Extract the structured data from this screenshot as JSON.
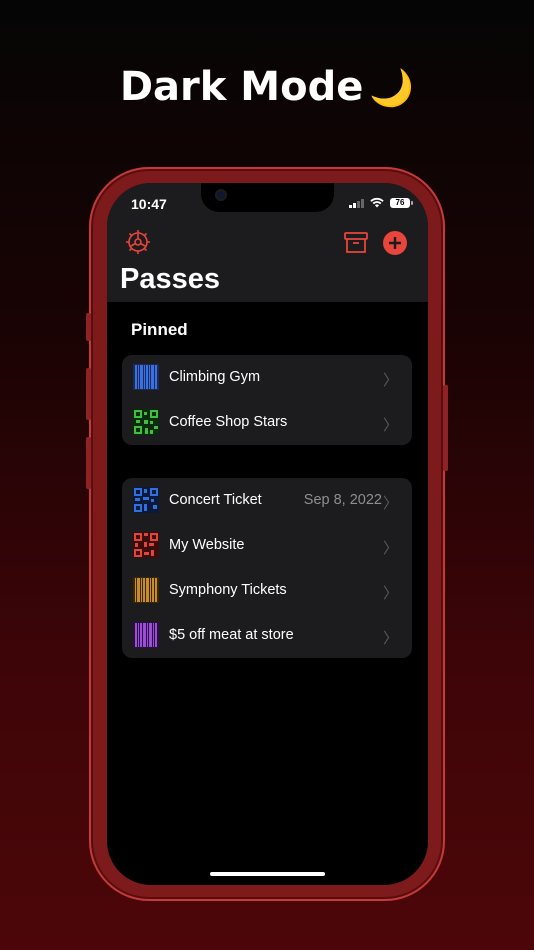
{
  "headline": {
    "text": "Dark Mode",
    "emoji": "🌙"
  },
  "status": {
    "time": "10:47",
    "battery": "76"
  },
  "header": {
    "title": "Passes"
  },
  "pinned": {
    "label": "Pinned",
    "items": [
      {
        "label": "Climbing Gym",
        "icon": "barcode",
        "color": "#2f5fd0"
      },
      {
        "label": "Coffee Shop Stars",
        "icon": "qr-code",
        "color": "#3fbf3f"
      }
    ]
  },
  "passes": {
    "items": [
      {
        "label": "Concert Ticket",
        "detail": "Sep 8, 2022",
        "icon": "qr-code",
        "color": "#2f6fe0"
      },
      {
        "label": "My Website",
        "icon": "qr-code",
        "color": "#e0443a"
      },
      {
        "label": "Symphony Tickets",
        "icon": "barcode",
        "color": "#c88c2a"
      },
      {
        "label": "$5 off meat at store",
        "icon": "barcode",
        "color": "#9b4fd6"
      }
    ]
  },
  "colors": {
    "accent": "#e8453c",
    "background": "#000000",
    "card": "#1c1c1e"
  }
}
